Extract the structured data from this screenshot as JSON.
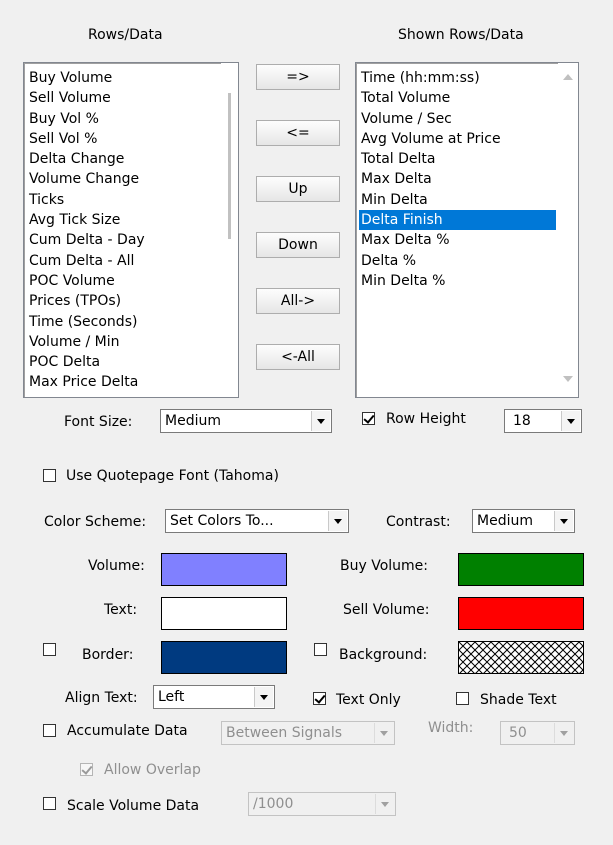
{
  "rows_data": {
    "title": "Rows/Data",
    "items": [
      "Buy Volume",
      "Sell Volume",
      "Buy Vol %",
      "Sell Vol %",
      "Delta Change",
      "Volume Change",
      "Ticks",
      "Avg Tick Size",
      "Cum Delta - Day",
      "Cum Delta - All",
      "POC Volume",
      "Prices (TPOs)",
      "Time (Seconds)",
      "Volume / Min",
      "POC Delta",
      "Max Price Delta"
    ]
  },
  "shown_rows": {
    "title": "Shown Rows/Data",
    "items": [
      "Time (hh:mm:ss)",
      "Total Volume",
      "Volume / Sec",
      "Avg Volume at Price",
      "Total Delta",
      "Max Delta",
      "Min Delta",
      "Delta Finish",
      "Max Delta %",
      "Delta %",
      "Min Delta %"
    ],
    "selected_index": 7
  },
  "buttons": {
    "add": "=>",
    "remove": "<=",
    "up": "Up",
    "down": "Down",
    "all_add": "All->",
    "all_remove": "<-All"
  },
  "font_size": {
    "label": "Font Size:",
    "value": "Medium"
  },
  "row_height": {
    "label": "Row Height",
    "checked": true,
    "value": "18"
  },
  "quotepage_font": {
    "label": "Use Quotepage Font (Tahoma)",
    "checked": false
  },
  "color_scheme": {
    "label": "Color Scheme:",
    "value": "Set Colors To..."
  },
  "contrast": {
    "label": "Contrast:",
    "value": "Medium"
  },
  "colors": {
    "volume": {
      "label": "Volume:",
      "color": "#8080ff"
    },
    "text": {
      "label": "Text:",
      "color": "#ffffff"
    },
    "border": {
      "label": "Border:",
      "color": "#003a80",
      "checked": false
    },
    "buy_volume": {
      "label": "Buy Volume:",
      "color": "#008000"
    },
    "sell_volume": {
      "label": "Sell Volume:",
      "color": "#ff0000"
    },
    "background": {
      "label": "Background:",
      "pattern": "crosshatch",
      "checked": false
    }
  },
  "align_text": {
    "label": "Align Text:",
    "value": "Left"
  },
  "text_only": {
    "label": "Text Only",
    "checked": true
  },
  "shade_text": {
    "label": "Shade Text",
    "checked": false
  },
  "accumulate": {
    "label": "Accumulate Data",
    "checked": false,
    "mode": "Between Signals",
    "width_label": "Width:",
    "width": "50"
  },
  "allow_overlap": {
    "label": "Allow Overlap",
    "checked": true,
    "disabled": true
  },
  "scale_volume": {
    "label": "Scale Volume Data",
    "checked": false,
    "value": "/1000"
  }
}
